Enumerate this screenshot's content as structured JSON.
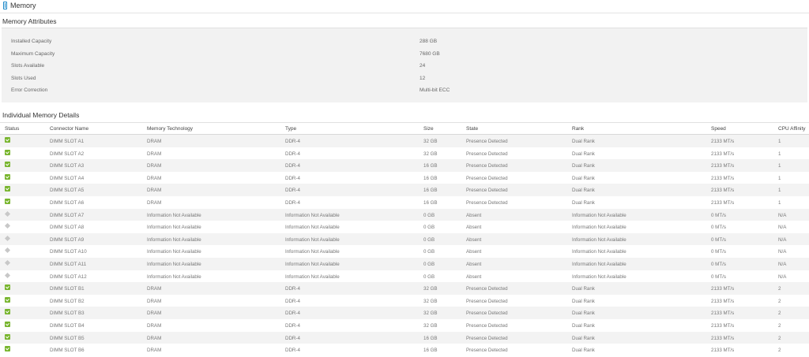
{
  "header": {
    "title": "Memory"
  },
  "attributes": {
    "title": "Memory Attributes",
    "items": [
      {
        "label": "Installed Capacity",
        "value": "288 GB"
      },
      {
        "label": "Maximum Capacity",
        "value": "7680 GB"
      },
      {
        "label": "Slots Available",
        "value": "24"
      },
      {
        "label": "Slots Used",
        "value": "12"
      },
      {
        "label": "Error Correction",
        "value": "Multi-bit ECC"
      }
    ]
  },
  "details": {
    "title": "Individual Memory Details",
    "columns": {
      "status": "Status",
      "connector": "Connector Name",
      "technology": "Memory Technology",
      "type": "Type",
      "size": "Size",
      "state": "State",
      "rank": "Rank",
      "speed": "Speed",
      "affinity": "CPU Affinity"
    },
    "rows": [
      {
        "status": "ok",
        "connector": "DIMM SLOT A1",
        "technology": "DRAM",
        "type": "DDR-4",
        "size": "32 GB",
        "state": "Presence Detected",
        "rank": "Dual Rank",
        "speed": "2133 MT/s",
        "affinity": "1"
      },
      {
        "status": "ok",
        "connector": "DIMM SLOT A2",
        "technology": "DRAM",
        "type": "DDR-4",
        "size": "32 GB",
        "state": "Presence Detected",
        "rank": "Dual Rank",
        "speed": "2133 MT/s",
        "affinity": "1"
      },
      {
        "status": "ok",
        "connector": "DIMM SLOT A3",
        "technology": "DRAM",
        "type": "DDR-4",
        "size": "16 GB",
        "state": "Presence Detected",
        "rank": "Dual Rank",
        "speed": "2133 MT/s",
        "affinity": "1"
      },
      {
        "status": "ok",
        "connector": "DIMM SLOT A4",
        "technology": "DRAM",
        "type": "DDR-4",
        "size": "16 GB",
        "state": "Presence Detected",
        "rank": "Dual Rank",
        "speed": "2133 MT/s",
        "affinity": "1"
      },
      {
        "status": "ok",
        "connector": "DIMM SLOT A5",
        "technology": "DRAM",
        "type": "DDR-4",
        "size": "16 GB",
        "state": "Presence Detected",
        "rank": "Dual Rank",
        "speed": "2133 MT/s",
        "affinity": "1"
      },
      {
        "status": "ok",
        "connector": "DIMM SLOT A6",
        "technology": "DRAM",
        "type": "DDR-4",
        "size": "16 GB",
        "state": "Presence Detected",
        "rank": "Dual Rank",
        "speed": "2133 MT/s",
        "affinity": "1"
      },
      {
        "status": "unknown",
        "connector": "DIMM SLOT A7",
        "technology": "Information Not Available",
        "type": "Information Not Available",
        "size": "0 GB",
        "state": "Absent",
        "rank": "Information Not Available",
        "speed": "0 MT/s",
        "affinity": "N/A"
      },
      {
        "status": "unknown",
        "connector": "DIMM SLOT A8",
        "technology": "Information Not Available",
        "type": "Information Not Available",
        "size": "0 GB",
        "state": "Absent",
        "rank": "Information Not Available",
        "speed": "0 MT/s",
        "affinity": "N/A"
      },
      {
        "status": "unknown",
        "connector": "DIMM SLOT A9",
        "technology": "Information Not Available",
        "type": "Information Not Available",
        "size": "0 GB",
        "state": "Absent",
        "rank": "Information Not Available",
        "speed": "0 MT/s",
        "affinity": "N/A"
      },
      {
        "status": "unknown",
        "connector": "DIMM SLOT A10",
        "technology": "Information Not Available",
        "type": "Information Not Available",
        "size": "0 GB",
        "state": "Absent",
        "rank": "Information Not Available",
        "speed": "0 MT/s",
        "affinity": "N/A"
      },
      {
        "status": "unknown",
        "connector": "DIMM SLOT A11",
        "technology": "Information Not Available",
        "type": "Information Not Available",
        "size": "0 GB",
        "state": "Absent",
        "rank": "Information Not Available",
        "speed": "0 MT/s",
        "affinity": "N/A"
      },
      {
        "status": "unknown",
        "connector": "DIMM SLOT A12",
        "technology": "Information Not Available",
        "type": "Information Not Available",
        "size": "0 GB",
        "state": "Absent",
        "rank": "Information Not Available",
        "speed": "0 MT/s",
        "affinity": "N/A"
      },
      {
        "status": "ok",
        "connector": "DIMM SLOT B1",
        "technology": "DRAM",
        "type": "DDR-4",
        "size": "32 GB",
        "state": "Presence Detected",
        "rank": "Dual Rank",
        "speed": "2133 MT/s",
        "affinity": "2"
      },
      {
        "status": "ok",
        "connector": "DIMM SLOT B2",
        "technology": "DRAM",
        "type": "DDR-4",
        "size": "32 GB",
        "state": "Presence Detected",
        "rank": "Dual Rank",
        "speed": "2133 MT/s",
        "affinity": "2"
      },
      {
        "status": "ok",
        "connector": "DIMM SLOT B3",
        "technology": "DRAM",
        "type": "DDR-4",
        "size": "32 GB",
        "state": "Presence Detected",
        "rank": "Dual Rank",
        "speed": "2133 MT/s",
        "affinity": "2"
      },
      {
        "status": "ok",
        "connector": "DIMM SLOT B4",
        "technology": "DRAM",
        "type": "DDR-4",
        "size": "32 GB",
        "state": "Presence Detected",
        "rank": "Dual Rank",
        "speed": "2133 MT/s",
        "affinity": "2"
      },
      {
        "status": "ok",
        "connector": "DIMM SLOT B5",
        "technology": "DRAM",
        "type": "DDR-4",
        "size": "16 GB",
        "state": "Presence Detected",
        "rank": "Dual Rank",
        "speed": "2133 MT/s",
        "affinity": "2"
      },
      {
        "status": "ok",
        "connector": "DIMM SLOT B6",
        "technology": "DRAM",
        "type": "DDR-4",
        "size": "16 GB",
        "state": "Presence Detected",
        "rank": "Dual Rank",
        "speed": "2133 MT/s",
        "affinity": "2"
      }
    ]
  }
}
